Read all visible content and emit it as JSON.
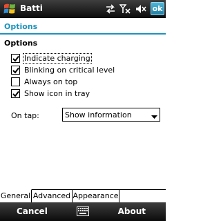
{
  "titlebar": {
    "app_title": "Batti",
    "ok_label": "ok",
    "icons": [
      "windows-start-icon",
      "sync-icon",
      "signal-off-icon",
      "speaker-muted-icon"
    ]
  },
  "page": {
    "title": "Options"
  },
  "options": {
    "section_title": "Options",
    "items": [
      {
        "label": "Indicate charging",
        "checked": true
      },
      {
        "label": "Blinking on critical level",
        "checked": true
      },
      {
        "label": "Always on top",
        "checked": false
      },
      {
        "label": "Show icon in tray",
        "checked": true
      }
    ],
    "on_tap_label": "On tap:",
    "on_tap_value": "Show information"
  },
  "tabs": [
    {
      "label": "General",
      "active": true
    },
    {
      "label": "Advanced",
      "active": false
    },
    {
      "label": "Appearance",
      "active": false
    }
  ],
  "menubar": {
    "left_label": "Cancel",
    "right_label": "About",
    "center_icon": "keyboard-icon"
  },
  "colors": {
    "accent": "#1a93bd",
    "bar_dark": "#0b0b0b"
  }
}
